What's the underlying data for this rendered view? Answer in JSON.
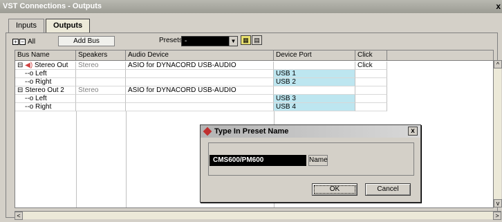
{
  "window": {
    "title": "VST Connections - Outputs",
    "close_glyph": "x"
  },
  "tabs": [
    {
      "label": "Inputs"
    },
    {
      "label": "Outputs"
    }
  ],
  "toolbar": {
    "all_label": "All",
    "add_bus_label": "Add Bus",
    "presets_label": "Presets",
    "preset_value": "-"
  },
  "columns": [
    "Bus Name",
    "Speakers",
    "Audio Device",
    "Device Port",
    "Click"
  ],
  "rows": [
    {
      "bus": "Stereo Out",
      "speakers": "Stereo",
      "device": "ASIO for DYNACORD USB-AUDIO",
      "port": "",
      "click": "Click"
    },
    {
      "bus": "Left",
      "speakers": "",
      "device": "",
      "port": "USB 1",
      "click": ""
    },
    {
      "bus": "Right",
      "speakers": "",
      "device": "",
      "port": "USB 2",
      "click": ""
    },
    {
      "bus": "Stereo Out 2",
      "speakers": "Stereo",
      "device": "ASIO for DYNACORD USB-AUDIO",
      "port": "",
      "click": ""
    },
    {
      "bus": "Left",
      "speakers": "",
      "device": "",
      "port": "USB 3",
      "click": ""
    },
    {
      "bus": "Right",
      "speakers": "",
      "device": "",
      "port": "USB 4",
      "click": ""
    }
  ],
  "dialog": {
    "title": "Type In Preset Name",
    "close_glyph": "x",
    "preset_name": "CMS600/PM600",
    "name_button": "Name",
    "ok_label": "OK",
    "cancel_label": "Cancel"
  },
  "colors": {
    "port_cell": "#bde6f0",
    "dialog_icon": "#c03030"
  }
}
